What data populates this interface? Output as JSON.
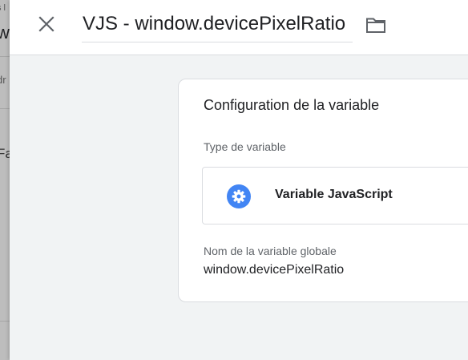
{
  "background_page": {
    "fragments": [
      "s l",
      "w",
      "dr",
      "Fa"
    ]
  },
  "header": {
    "title_value": "VJS - window.devicePixelRatio",
    "close_icon": "close-icon",
    "folder_icon": "folder-icon"
  },
  "card": {
    "title": "Configuration de la variable",
    "type_label": "Type de variable",
    "type_name": "Variable JavaScript",
    "type_icon": "gear-icon",
    "global_label": "Nom de la variable globale",
    "global_value": "window.devicePixelRatio"
  },
  "colors": {
    "accent": "#4285f4",
    "panel_bg": "#f1f3f4",
    "icon_gray": "#5f6368"
  }
}
